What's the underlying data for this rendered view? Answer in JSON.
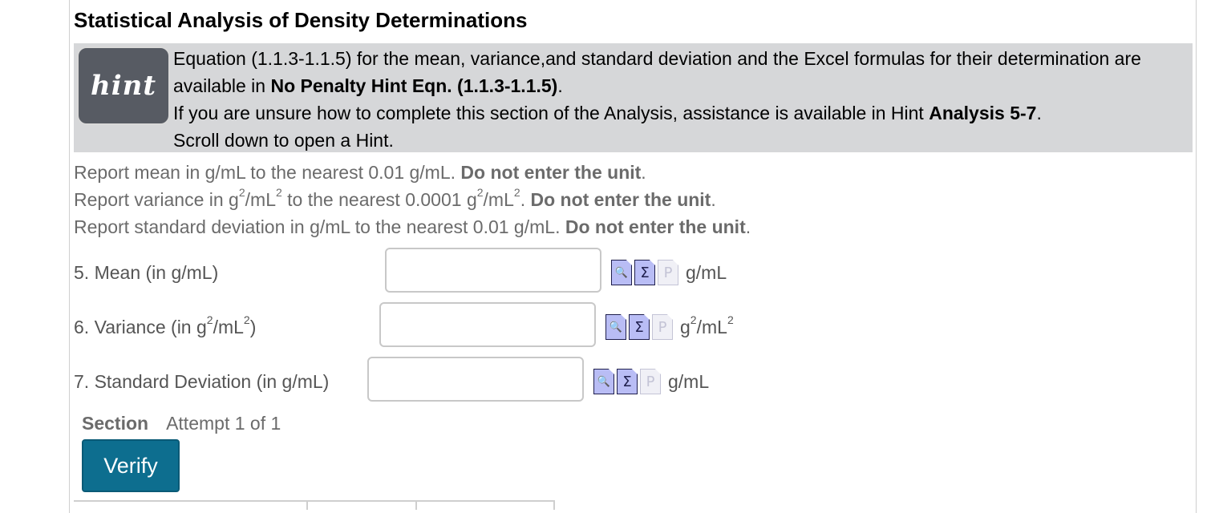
{
  "page": {
    "title": "Statistical Analysis of Density Determinations"
  },
  "hint": {
    "badge": "hint",
    "line1": "Equation (1.1.3-1.1.5) for the mean, variance,and standard deviation and the Excel formulas for their determination are",
    "line2_pre": "available in ",
    "line2_bold": "No Penalty Hint Eqn. (1.1.3-1.1.5)",
    "line2_post": ".",
    "line3_pre": "If you are unsure how to complete this section of the Analysis, assistance is available in Hint ",
    "line3_bold": "Analysis 5-7",
    "line3_post": ".",
    "line4": "Scroll down to open a Hint."
  },
  "instructions": {
    "mean": {
      "pre": "Report mean in g/mL to the nearest 0.01 g/mL.  ",
      "bold": "Do not enter the unit",
      "post": "."
    },
    "variance": {
      "p1": "Report variance in g",
      "sup1": "2",
      "p2": "/mL",
      "sup2": "2",
      "p3": " to the nearest 0.0001 g",
      "sup3": "2",
      "p4": "/mL",
      "sup4": "2",
      "p5": ".  ",
      "bold": "Do not enter the unit",
      "post": "."
    },
    "stdev": {
      "pre": "Report standard deviation in g/mL to the nearest 0.01 g/mL.  ",
      "bold": "Do not enter the unit",
      "post": "."
    }
  },
  "questions": {
    "q5": {
      "label": "5. Mean (in g/mL)",
      "value": "",
      "unit": "g/mL"
    },
    "q6": {
      "label_pre": "6. Variance (in g",
      "label_sup1": "2",
      "label_mid": "/mL",
      "label_sup2": "2",
      "label_post": ")",
      "value": "",
      "unit_pre": "g",
      "unit_sup1": "2",
      "unit_mid": "/mL",
      "unit_sup2": "2"
    },
    "q7": {
      "label": "7. Standard Deviation (in g/mL)",
      "value": "",
      "unit": "g/mL"
    }
  },
  "icons": {
    "view": "🔍",
    "sum": "Σ",
    "p": "P"
  },
  "section": {
    "label": "Section",
    "attempt": "Attempt 1 of 1"
  },
  "buttons": {
    "verify": "Verify"
  },
  "colors": {
    "accent": "#0d6e8f",
    "hint_bg": "#d6d7d9",
    "icon_fill": "#b9bdf5"
  }
}
